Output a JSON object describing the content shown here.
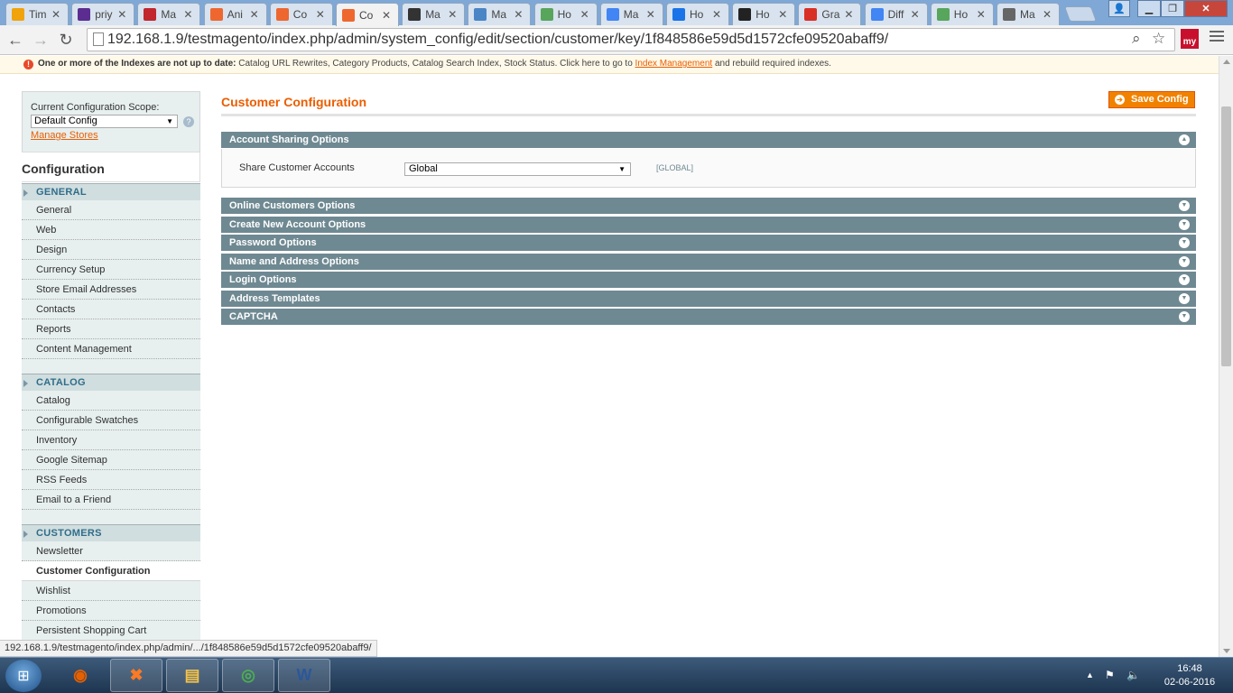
{
  "browser": {
    "tabs": [
      {
        "label": "Tim",
        "icon": "calendar-icon",
        "color": "#f0a30a"
      },
      {
        "label": "priy",
        "icon": "mail-icon",
        "color": "#5c2d91"
      },
      {
        "label": "Ma",
        "icon": "slide-icon",
        "color": "#c1272d"
      },
      {
        "label": "Ani",
        "icon": "magento-icon",
        "color": "#ee672f"
      },
      {
        "label": "Co",
        "icon": "magento-icon",
        "color": "#ee672f"
      },
      {
        "label": "Co",
        "icon": "magento-icon",
        "color": "#ee672f",
        "active": true
      },
      {
        "label": "Ma",
        "icon": "magento-dark-icon",
        "color": "#333333"
      },
      {
        "label": "Ma",
        "icon": "owl-icon",
        "color": "#4a86c5"
      },
      {
        "label": "Ho",
        "icon": "tile-icon",
        "color": "#58a55c"
      },
      {
        "label": "Ma",
        "icon": "google-icon",
        "color": "#4285f4"
      },
      {
        "label": "Ho",
        "icon": "n-icon",
        "color": "#1a73e8"
      },
      {
        "label": "Ho",
        "icon": "ch-icon",
        "color": "#222222"
      },
      {
        "label": "Gra",
        "icon": "globe-icon",
        "color": "#d93025"
      },
      {
        "label": "Diff",
        "icon": "google-icon",
        "color": "#4285f4"
      },
      {
        "label": "Ho",
        "icon": "tile-icon",
        "color": "#58a55c"
      },
      {
        "label": "Ma",
        "icon": "circle-icon",
        "color": "#666666"
      }
    ],
    "url": "192.168.1.9/testmagento/index.php/admin/system_config/edit/section/customer/key/1f848586e59d5d1572cfe09520abaff9/",
    "extension_label": "my",
    "status_url": "192.168.1.9/testmagento/index.php/admin/.../1f848586e59d5d1572cfe09520abaff9/"
  },
  "notice": {
    "bold": "One or more of the Indexes are not up to date:",
    "text": " Catalog URL Rewrites, Category Products, Catalog Search Index, Stock Status. Click here to go to ",
    "link": "Index Management",
    "tail": " and rebuild required indexes."
  },
  "scope": {
    "label": "Current Configuration Scope:",
    "value": "Default Config",
    "manage_link": "Manage Stores"
  },
  "sidebar": {
    "title": "Configuration",
    "groups": [
      {
        "title": "GENERAL",
        "items": [
          "General",
          "Web",
          "Design",
          "Currency Setup",
          "Store Email Addresses",
          "Contacts",
          "Reports",
          "Content Management"
        ]
      },
      {
        "title": "CATALOG",
        "items": [
          "Catalog",
          "Configurable Swatches",
          "Inventory",
          "Google Sitemap",
          "RSS Feeds",
          "Email to a Friend"
        ]
      },
      {
        "title": "CUSTOMERS",
        "items": [
          "Newsletter",
          "Customer Configuration",
          "Wishlist",
          "Promotions",
          "Persistent Shopping Cart"
        ]
      }
    ],
    "active_item": "Customer Configuration"
  },
  "main": {
    "title": "Customer Configuration",
    "save_label": "Save Config",
    "open_section": {
      "title": "Account Sharing Options",
      "field_label": "Share Customer Accounts",
      "field_value": "Global",
      "scope": "[GLOBAL]"
    },
    "sections": [
      "Online Customers Options",
      "Create New Account Options",
      "Password Options",
      "Name and Address Options",
      "Login Options",
      "Address Templates",
      "CAPTCHA"
    ]
  },
  "taskbar": {
    "apps": [
      {
        "name": "firefox",
        "glyph": "◉",
        "color": "#e66000"
      },
      {
        "name": "xampp",
        "glyph": "✖",
        "color": "#fb7a24"
      },
      {
        "name": "explorer",
        "glyph": "▤",
        "color": "#f3c34a"
      },
      {
        "name": "chrome",
        "glyph": "◎",
        "color": "#4caf50"
      },
      {
        "name": "word",
        "glyph": "W",
        "color": "#2b579a"
      }
    ],
    "time": "16:48",
    "date": "02-06-2016"
  }
}
